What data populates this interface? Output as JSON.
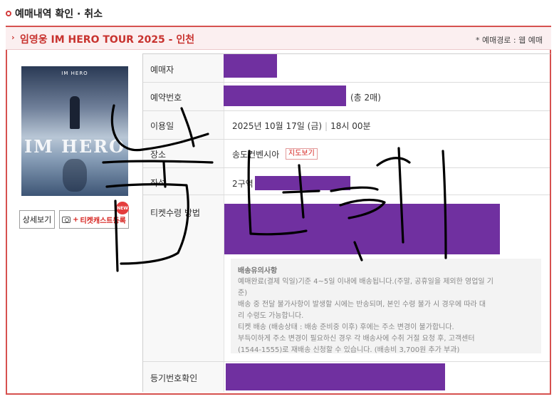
{
  "page": {
    "title": "예매내역 확인 · 취소"
  },
  "event": {
    "title": "임영웅 IM HERO TOUR 2025 - 인천",
    "route": "* 예매경로 : 웹 예매"
  },
  "poster": {
    "header_text": "IM HERO",
    "logo_text": "IM HERO"
  },
  "buttons": {
    "detail": "상세보기",
    "ticketcast": "티켓캐스트등록",
    "new_badge": "NEW"
  },
  "labels": {
    "booker": "예매자",
    "booking_number": "예약번호",
    "date": "이용일",
    "venue": "장소",
    "seat": "좌석",
    "delivery": "티켓수령 방법",
    "registered": "등기번호확인"
  },
  "values": {
    "ticket_count": "(총 2매)",
    "date_day": "2025년 10월 17일 (금)",
    "date_time": "18시 00분",
    "venue": "송도컨벤시아",
    "map_button": "지도보기",
    "seat_zone": "2구역"
  },
  "notice": {
    "title": "배송유의사항",
    "lines": [
      "예매완료(결제 익일)기준 4~5일 이내에 배송됩니다.(주말, 공휴일을 제외한 영업일 기",
      "준)",
      "배송 중 전달 불가사항이 발생할 시에는 반송되며, 본인 수령 불가 시 경우에 따라 대",
      "리 수령도 가능합니다.",
      "티켓 배송 (배송상태 : 배송 준비중 이후) 후에는 주소 변경이 불가합니다.",
      "부득이하게 주소 변경이 필요하신 경우 각 배송사에 수취 거절 요청 후, 고객센터",
      "(1544-1555)로 재배송 신청할 수 있습니다. (배송비 3,700원 추가 부과)"
    ]
  },
  "colors": {
    "accent": "#d6514f",
    "redaction": "#7030a0"
  }
}
